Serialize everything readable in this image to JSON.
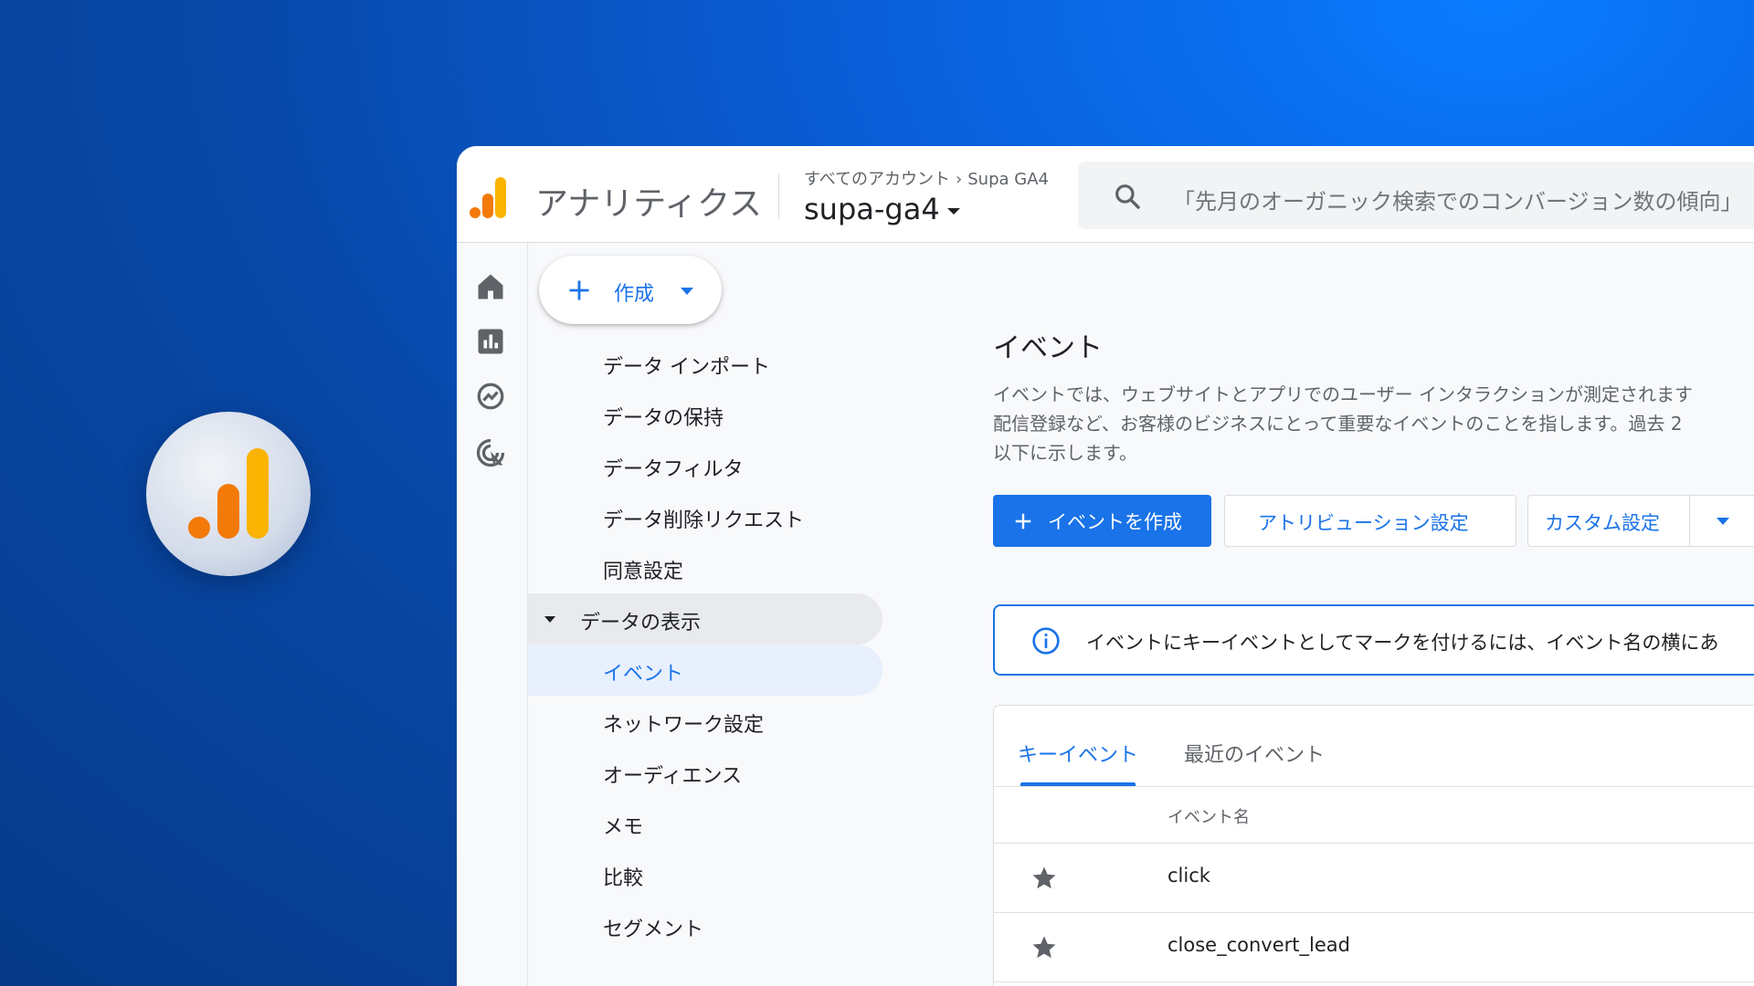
{
  "header": {
    "app_title": "アナリティクス",
    "breadcrumb_parent": "すべてのアカウント",
    "breadcrumb_child": "Supa GA4",
    "property_name": "supa-ga4",
    "search_placeholder": "「先月のオーガニック検索でのコンバージョン数の傾向」"
  },
  "create": {
    "label": "作成"
  },
  "nav": {
    "items": [
      "データ インポート",
      "データの保持",
      "データフィルタ",
      "データ削除リクエスト",
      "同意設定"
    ],
    "group": "データの表示",
    "active": "イベント",
    "subitems": [
      "ネットワーク設定",
      "オーディエンス",
      "メモ",
      "比較",
      "セグメント"
    ]
  },
  "main": {
    "title": "イベント",
    "desc_line1": "イベントでは、ウェブサイトとアプリでのユーザー インタラクションが測定されます",
    "desc_line2": "配信登録など、お客様のビジネスにとって重要なイベントのことを指します。過去 2",
    "desc_line3": "以下に示します。",
    "btn_create": "イベントを作成",
    "btn_attribution": "アトリビューション設定",
    "btn_custom": "カスタム設定",
    "info_text": "イベントにキーイベントとしてマークを付けるには、イベント名の横にあ",
    "tab_key": "キーイベント",
    "tab_recent": "最近のイベント",
    "col_event_name": "イベント名",
    "rows": [
      "click",
      "close_convert_lead"
    ]
  },
  "colors": {
    "accent": "#1a73e8",
    "logo_orange": "#f37a08",
    "logo_yellow": "#fbb301"
  }
}
